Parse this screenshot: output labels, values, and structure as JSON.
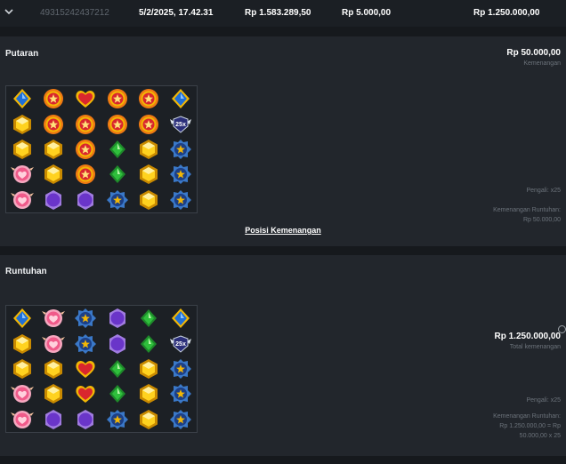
{
  "row": {
    "transaction_id": "49315242437212",
    "datetime": "5/2/2025, 17.42.31",
    "balance": "Rp 1.583.289,50",
    "bet": "Rp 5.000,00",
    "win": "Rp 1.250.000,00"
  },
  "putaran": {
    "title": "Putaran",
    "amount": "Rp 50.000,00",
    "amount_label": "Kemenangan",
    "pengali": "Pengali: x25",
    "cascade_label": "Kemenangan Runtuhan:",
    "cascade_value": "Rp 50.000,00",
    "posisi_link": "Posisi Kemenangan",
    "grid": [
      [
        "blue-diamond",
        "red-star",
        "red-heart",
        "red-star",
        "red-star",
        "blue-diamond"
      ],
      [
        "yellow-hex",
        "red-star",
        "red-star",
        "red-star",
        "red-star",
        "multiplier-25x"
      ],
      [
        "yellow-hex",
        "yellow-hex",
        "red-star",
        "green-diamond",
        "yellow-hex",
        "blue-star"
      ],
      [
        "pink-heart",
        "yellow-hex",
        "red-star",
        "green-diamond",
        "yellow-hex",
        "blue-star"
      ],
      [
        "pink-heart",
        "purple-moon",
        "purple-moon",
        "blue-star",
        "yellow-hex",
        "blue-star"
      ]
    ],
    "multiplier_text": "25x"
  },
  "runtuhan": {
    "title": "Runtuhan",
    "amount": "Rp 1.250.000,00",
    "amount_label": "Total kemenangan",
    "pengali": "Pengali: x25",
    "cascade_label": "Kemenangan Runtuhan:",
    "cascade_value_1": "Rp 1.250.000,00 = Rp",
    "cascade_value_2": "50.000,00 x 25",
    "grid": [
      [
        "blue-diamond",
        "pink-heart",
        "blue-star",
        "purple-moon",
        "green-diamond",
        "blue-diamond"
      ],
      [
        "yellow-hex",
        "pink-heart",
        "blue-star",
        "purple-moon",
        "green-diamond",
        "multiplier-25x"
      ],
      [
        "yellow-hex",
        "yellow-hex",
        "red-heart",
        "green-diamond",
        "yellow-hex",
        "blue-star"
      ],
      [
        "pink-heart",
        "yellow-hex",
        "red-heart",
        "green-diamond",
        "yellow-hex",
        "blue-star"
      ],
      [
        "pink-heart",
        "purple-moon",
        "purple-moon",
        "blue-star",
        "yellow-hex",
        "blue-star"
      ]
    ],
    "multiplier_text": "25x"
  },
  "colors": {
    "background": "#16191d",
    "panel": "#22262c",
    "muted_text": "#6c737b",
    "red_gem": "#d9262e",
    "gold": "#f2b705",
    "blue_gem": "#1f6fd8",
    "green_gem": "#2fbf3c",
    "purple_gem": "#6a35c9",
    "pink_gem": "#f05a8a"
  }
}
